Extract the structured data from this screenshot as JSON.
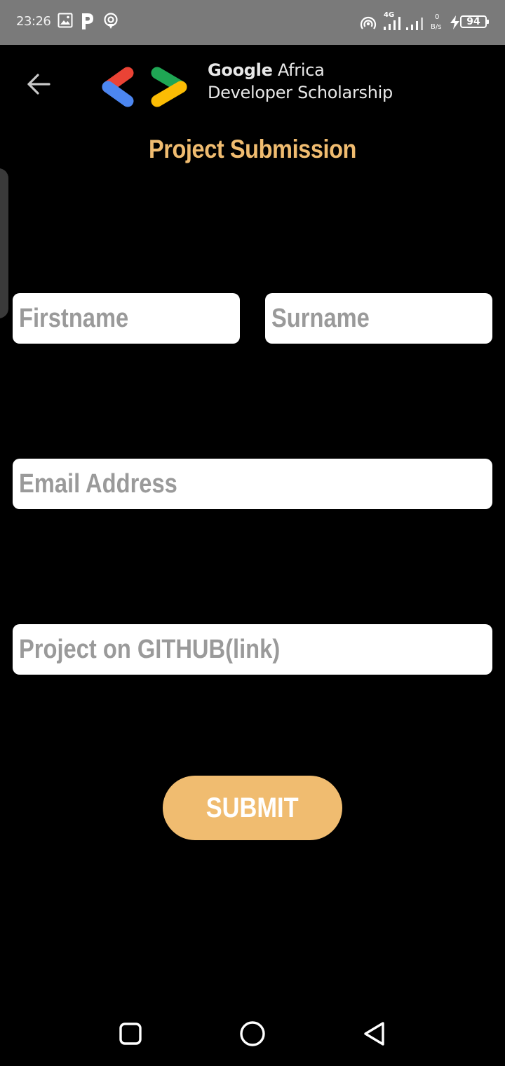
{
  "status_bar": {
    "time": "23:26",
    "network_type": "4G",
    "data_rate_value": "0",
    "data_rate_unit": "B/s",
    "battery_level": "94",
    "icons": [
      "image-icon",
      "pinterest-p-icon",
      "location-broadcast-icon",
      "hotspot-icon",
      "signal-icon",
      "signal-icon-2",
      "charging-icon"
    ]
  },
  "header": {
    "back_icon": "arrow-left-icon",
    "logo_line1_brand": "Google",
    "logo_line1_rest": " Africa",
    "logo_line2": "Developer Scholarship",
    "logo_colors": {
      "blue": "#4c86f0",
      "red": "#ea4335",
      "green": "#1fa654",
      "yellow": "#fbbc04"
    }
  },
  "page": {
    "title": "Project Submission",
    "accent_color": "#f0bc70"
  },
  "form": {
    "firstname": {
      "value": "",
      "placeholder": "Firstname"
    },
    "surname": {
      "value": "",
      "placeholder": "Surname"
    },
    "email": {
      "value": "",
      "placeholder": "Email Address"
    },
    "github": {
      "value": "",
      "placeholder": "Project on GITHUB(link)"
    },
    "submit_label": "SUBMIT"
  },
  "nav_bar": {
    "icons": [
      "recents-square-icon",
      "home-circle-icon",
      "back-triangle-icon"
    ]
  }
}
